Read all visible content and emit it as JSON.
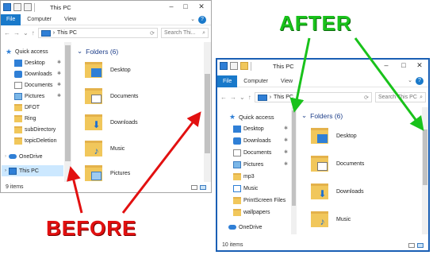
{
  "before": {
    "window_title": "This PC",
    "tabs": [
      "File",
      "Computer",
      "View"
    ],
    "address": "This PC",
    "search_placeholder": "Search Thi...",
    "nav_items": [
      "Quick access",
      "Desktop",
      "Downloads",
      "Documents",
      "Pictures",
      "DFOT",
      "Ring",
      "subDirectory",
      "topicDeletion",
      "OneDrive",
      "This PC"
    ],
    "group_header": "Folders (6)",
    "folders": [
      "Desktop",
      "Documents",
      "Downloads",
      "Music",
      "Pictures"
    ],
    "status": "9 items"
  },
  "after": {
    "window_title": "This PC",
    "tabs": [
      "File",
      "Computer",
      "View"
    ],
    "address": "This PC",
    "search_placeholder": "Search This PC",
    "nav_items": [
      "Quick access",
      "Desktop",
      "Downloads",
      "Documents",
      "Pictures",
      "mp3",
      "Music",
      "PrintScreen Files",
      "wallpapers",
      "OneDrive"
    ],
    "group_header": "Folders (6)",
    "folders": [
      "Desktop",
      "Documents",
      "Downloads",
      "Music"
    ],
    "status": "10 items"
  },
  "annotations": {
    "before_label": "BEFORE",
    "after_label": "AFTER"
  },
  "colors": {
    "before_label": "#e21010",
    "after_label": "#19c21b",
    "accent": "#1979ca"
  }
}
